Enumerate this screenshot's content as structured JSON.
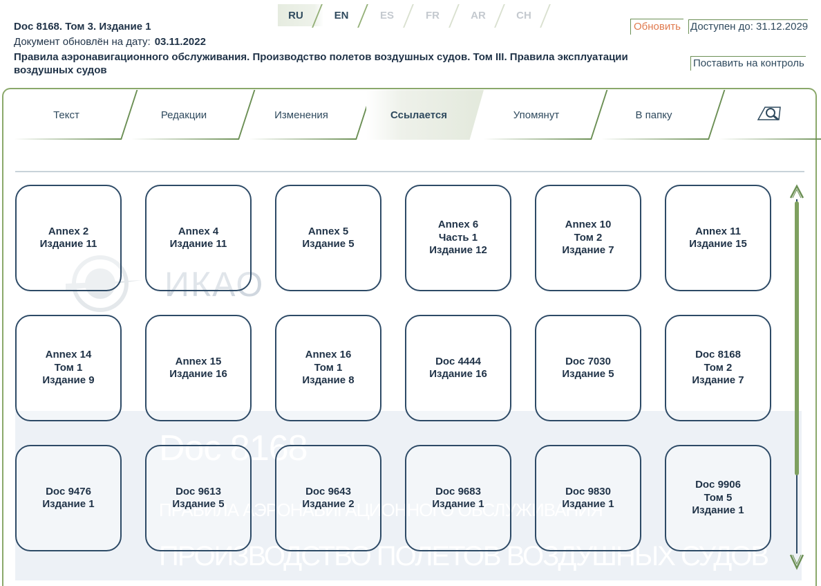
{
  "languages": [
    {
      "code": "RU",
      "state": "active"
    },
    {
      "code": "EN",
      "state": "on"
    },
    {
      "code": "ES",
      "state": "dis"
    },
    {
      "code": "FR",
      "state": "dis"
    },
    {
      "code": "AR",
      "state": "dis"
    },
    {
      "code": "CH",
      "state": "dis"
    }
  ],
  "header": {
    "doc_title": "Doc 8168. Том 3. Издание 1",
    "updated_label": "Документ обновлён на дату:",
    "updated_date": "03.11.2022",
    "description": "Правила аэронавигационного обслуживания. Производство полетов воздушных судов. Том III. Правила эксплуатации воздушных судов",
    "refresh_label": "Обновить",
    "available_label": "Доступен до: 31.12.2029",
    "watch_label": "Поставить на контроль"
  },
  "nav": {
    "tabs": [
      {
        "label": "Текст"
      },
      {
        "label": "Редакции"
      },
      {
        "label": "Изменения"
      },
      {
        "label": "Ссылается",
        "active": true
      },
      {
        "label": "Упомянут"
      },
      {
        "label": "В папку"
      }
    ],
    "search_icon": "search-icon"
  },
  "watermark": {
    "logo_text": "ИКАО",
    "line1": "Doc 8168",
    "line2": "ПРАВИЛА АЭРОНАВИГАЦИОННОГО ОБСЛУЖИВАНИЯ",
    "line3": "ПРОИЗВОДСТВО ПОЛЕТОВ ВОЗДУШНЫХ СУДОВ"
  },
  "cards": [
    {
      "lines": [
        "Annex 2",
        "Издание 11"
      ]
    },
    {
      "lines": [
        "Annex 4",
        "Издание 11"
      ]
    },
    {
      "lines": [
        "Annex 5",
        "Издание 5"
      ]
    },
    {
      "lines": [
        "Annex 6",
        "Часть 1",
        "Издание 12"
      ]
    },
    {
      "lines": [
        "Annex 10",
        "Том 2",
        "Издание 7"
      ]
    },
    {
      "lines": [
        "Annex 11",
        "Издание 15"
      ]
    },
    {
      "lines": [
        "Annex 14",
        "Том 1",
        "Издание 9"
      ]
    },
    {
      "lines": [
        "Annex 15",
        "Издание 16"
      ]
    },
    {
      "lines": [
        "Annex 16",
        "Том 1",
        "Издание 8"
      ]
    },
    {
      "lines": [
        "Doc 4444",
        "Издание 16"
      ]
    },
    {
      "lines": [
        "Doc 7030",
        "Издание 5"
      ]
    },
    {
      "lines": [
        "Doc 8168",
        "Том 2",
        "Издание 7"
      ]
    },
    {
      "lines": [
        "Doc 9476",
        "Издание 1"
      ]
    },
    {
      "lines": [
        "Doc 9613",
        "Издание 5"
      ]
    },
    {
      "lines": [
        "Doc 9643",
        "Издание 2"
      ]
    },
    {
      "lines": [
        "Doc 9683",
        "Издание 1"
      ]
    },
    {
      "lines": [
        "Doc 9830",
        "Издание 1"
      ]
    },
    {
      "lines": [
        "Doc 9906",
        "Том 5",
        "Издание 1"
      ]
    }
  ],
  "colors": {
    "accent_green": "#6b8f54",
    "card_border": "#2d4a66",
    "refresh": "#e07a4e"
  }
}
